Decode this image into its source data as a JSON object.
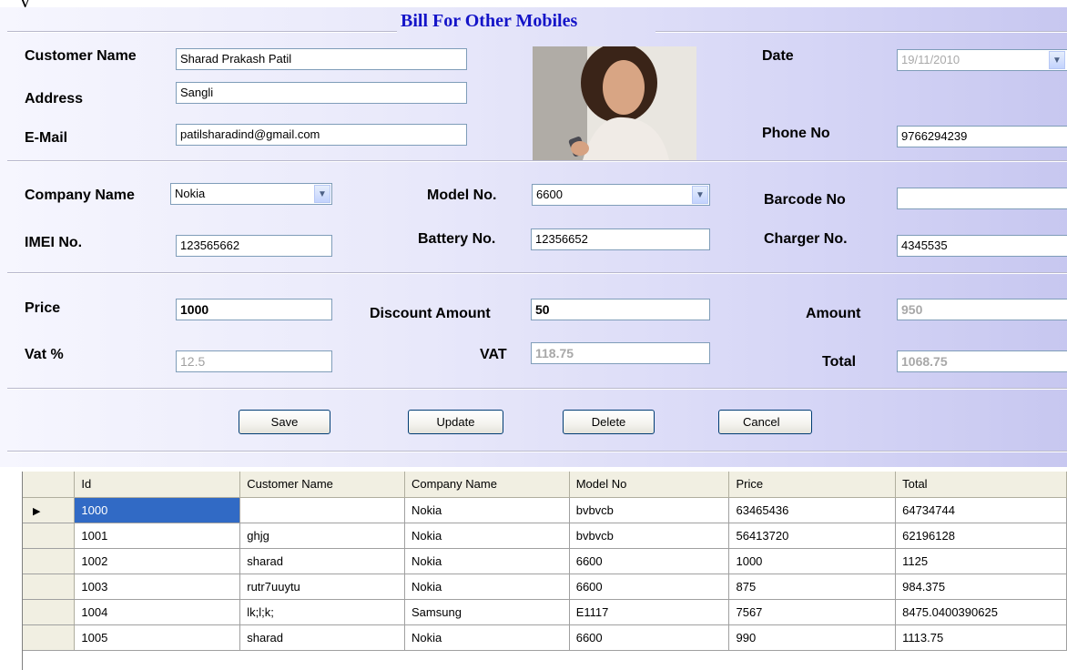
{
  "window": {
    "title": "Bill For Other Mobiles"
  },
  "customer": {
    "name_label": "Customer Name",
    "name_value": "Sharad Prakash Patil",
    "address_label": "Address",
    "address_value": "Sangli",
    "email_label": "E-Mail",
    "email_value": "patilsharadind@gmail.com",
    "date_label": "Date",
    "date_value": "19/11/2010",
    "phone_label": "Phone No",
    "phone_value": "9766294239"
  },
  "device": {
    "company_label": "Company Name",
    "company_value": "Nokia",
    "model_label": "Model No.",
    "model_value": "6600",
    "barcode_label": "Barcode No",
    "barcode_value": "",
    "imei_label": "IMEI No.",
    "imei_value": "123565662",
    "battery_label": "Battery No.",
    "battery_value": "12356652",
    "charger_label": "Charger No.",
    "charger_value": "4345535"
  },
  "pricing": {
    "price_label": "Price",
    "price_value": "1000",
    "discount_label": "Discount Amount",
    "discount_value": "50",
    "amount_label": "Amount",
    "amount_value": "950",
    "vat_pct_label": "Vat %",
    "vat_pct_value": "12.5",
    "vat_label": "VAT",
    "vat_value": "118.75",
    "total_label": "Total",
    "total_value": "1068.75"
  },
  "buttons": {
    "save": "Save",
    "update": "Update",
    "delete": "Delete",
    "cancel": "Cancel"
  },
  "grid": {
    "columns": [
      "Id",
      "Customer Name",
      "Company Name",
      "Model No",
      "Price",
      "Total"
    ],
    "rows": [
      [
        "1000",
        "",
        "Nokia",
        "bvbvcb",
        "63465436",
        "64734744"
      ],
      [
        "1001",
        "ghjg",
        "Nokia",
        "bvbvcb",
        "56413720",
        "62196128"
      ],
      [
        "1002",
        "sharad",
        "Nokia",
        "6600",
        "1000",
        "1125"
      ],
      [
        "1003",
        "rutr7uuytu",
        "Nokia",
        "6600",
        "875",
        "984.375"
      ],
      [
        "1004",
        "lk;l;k;",
        "Samsung",
        "E1117",
        "7567",
        "8475.0400390625"
      ],
      [
        "1005",
        "sharad",
        "Nokia",
        "6600",
        "990",
        "1113.75"
      ]
    ],
    "selected_row": 0
  },
  "colors": {
    "title": "#1414c8",
    "selection": "#316ac5",
    "header": "#f1efe2"
  }
}
